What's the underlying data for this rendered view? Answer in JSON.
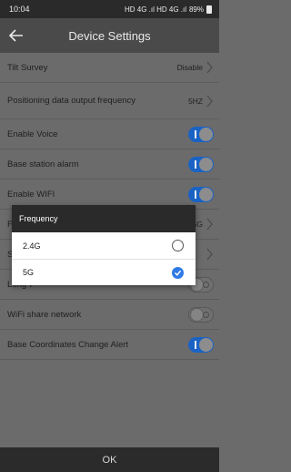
{
  "status": {
    "time": "10:04",
    "network": "HD 4G .ıl HD 4G .ıl",
    "battery": "89%"
  },
  "header": {
    "title": "Device Settings",
    "back_icon": "arrow-left-icon"
  },
  "settings": [
    {
      "label": "Tilt Survey",
      "value": "Disable",
      "kind": "select"
    },
    {
      "label": "Positioning data output frequency",
      "value": "5HZ",
      "kind": "select"
    },
    {
      "label": "Enable Voice",
      "kind": "toggle",
      "on": true
    },
    {
      "label": "Base station alarm",
      "kind": "toggle",
      "on": true
    },
    {
      "label": "Enable WIFI",
      "kind": "toggle",
      "on": true
    },
    {
      "label": "Frequ",
      "value": "5G",
      "kind": "select"
    },
    {
      "label": "Satell",
      "kind": "select"
    },
    {
      "label": "Long-t",
      "kind": "toggle",
      "on": false
    },
    {
      "label": "WiFi share network",
      "kind": "toggle",
      "on": false
    },
    {
      "label": "Base Coordinates Change Alert",
      "kind": "toggle",
      "on": true
    }
  ],
  "dialog": {
    "title": "Frequency",
    "options": [
      {
        "label": "2.4G",
        "selected": false
      },
      {
        "label": "5G",
        "selected": true
      }
    ]
  },
  "footer": {
    "ok_label": "OK"
  },
  "colors": {
    "accent": "#1a63c4",
    "radio_selected": "#2f7ae5",
    "overlay_bg": "#6b6b6b"
  }
}
